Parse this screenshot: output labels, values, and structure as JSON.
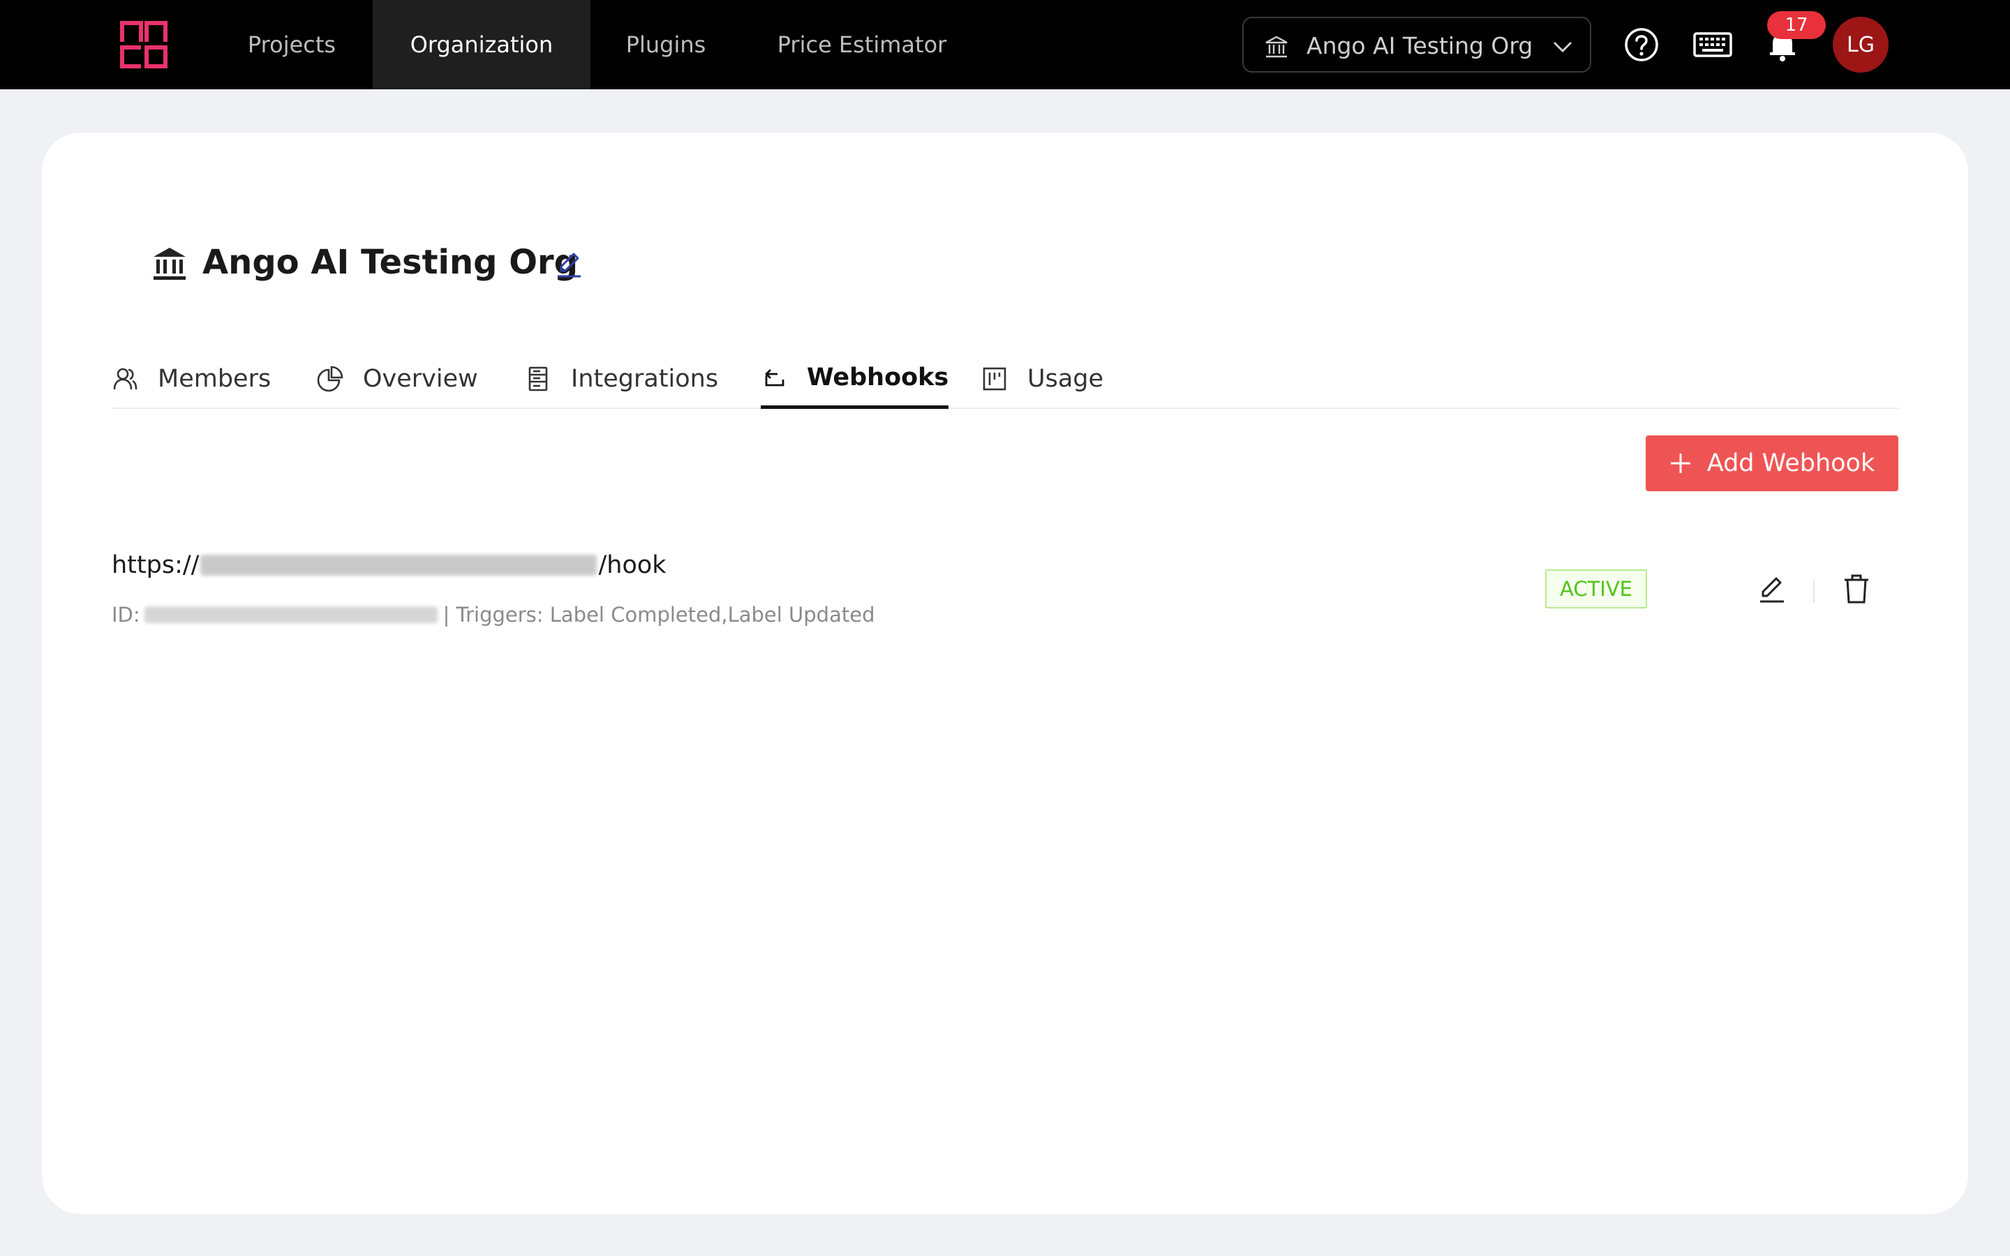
{
  "topnav": {
    "items": [
      {
        "label": "Projects",
        "active": false
      },
      {
        "label": "Organization",
        "active": true
      },
      {
        "label": "Plugins",
        "active": false
      },
      {
        "label": "Price Estimator",
        "active": false
      }
    ],
    "org_selector": {
      "value": "Ango AI Testing Org"
    },
    "notifications_count": "17",
    "avatar_initials": "LG",
    "brand_color": "#e8336b"
  },
  "organization": {
    "name": "Ango AI Testing Org"
  },
  "tabs": [
    {
      "label": "Members",
      "icon": "members-icon",
      "active": false
    },
    {
      "label": "Overview",
      "icon": "pie-chart-icon",
      "active": false
    },
    {
      "label": "Integrations",
      "icon": "server-icon",
      "active": false
    },
    {
      "label": "Webhooks",
      "icon": "webhook-icon",
      "active": true
    },
    {
      "label": "Usage",
      "icon": "usage-icon",
      "active": false
    }
  ],
  "actions": {
    "add_webhook_label": "Add Webhook",
    "accent_color": "#ef5454"
  },
  "webhooks": [
    {
      "url_prefix": "https://",
      "url_suffix": "/hook",
      "id_label": "ID:",
      "triggers_text": "| Triggers: Label Completed,Label Updated",
      "status": "ACTIVE",
      "status_color": "#52c41a"
    }
  ]
}
